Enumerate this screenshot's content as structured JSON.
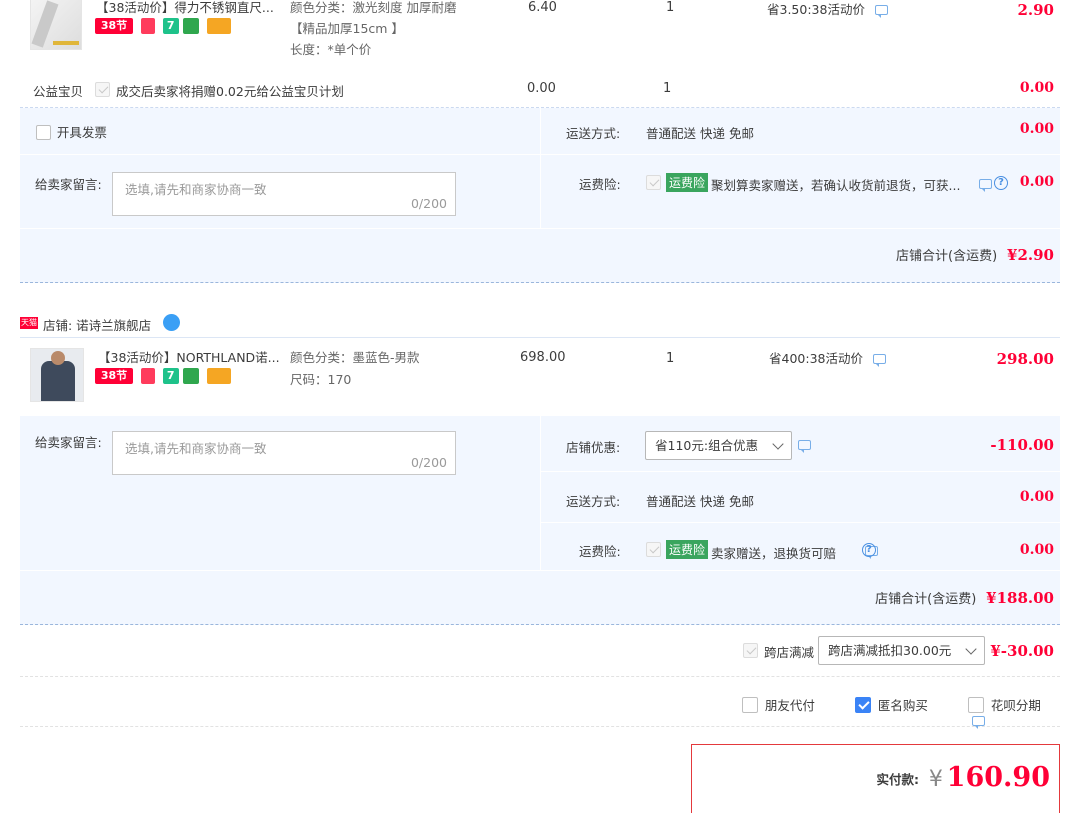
{
  "colors": {
    "price": "#ff0036",
    "panel_bg": "#f2f7ff",
    "checkbox_checked": "#3a83f6",
    "tag_green": "#3aa55e",
    "total_border": "#e4393c"
  },
  "item1": {
    "title": "【38活动价】得力不锈钢直尺...",
    "badges": [
      "38节",
      "shield",
      "7",
      "leaf",
      "card"
    ],
    "attrs": [
      "颜色分类：激光刻度 加厚耐磨",
      "【精品加厚15cm 】",
      "长度：*单个价"
    ],
    "unit_price": "6.40",
    "qty": "1",
    "discount": "省3.50:38活动价",
    "subtotal": "2.90"
  },
  "charity": {
    "label": "公益宝贝",
    "desc": "成交后卖家将捐赠0.02元给公益宝贝计划",
    "price": "0.00",
    "qty": "1",
    "subtotal": "0.00"
  },
  "shop1": {
    "invoice_label": "开具发票",
    "shipping_label": "运送方式:",
    "shipping_value": "普通配送 快递 免邮",
    "shipping_fee": "0.00",
    "message_label": "给卖家留言:",
    "message_placeholder": "选填,请先和商家协商一致",
    "message_count": "0/200",
    "insurance_label": "运费险:",
    "insurance_tag": "运费险",
    "insurance_desc": "聚划算卖家赠送，若确认收货前退货，可获...",
    "insurance_fee": "0.00",
    "total_label": "店铺合计(含运费)",
    "total_value": "¥2.90"
  },
  "shop2": {
    "store_tag": "天猫",
    "store_name": "店铺: 诺诗兰旗舰店",
    "item": {
      "title": "【38活动价】NORTHLAND诺...",
      "badges": [
        "38节",
        "shield",
        "7",
        "leaf",
        "card"
      ],
      "attrs": [
        "颜色分类：墨蓝色-男款",
        "尺码：170"
      ],
      "unit_price": "698.00",
      "qty": "1",
      "discount": "省400:38活动价",
      "subtotal": "298.00"
    },
    "message_label": "给卖家留言:",
    "message_placeholder": "选填,请先和商家协商一致",
    "message_count": "0/200",
    "coupon_label": "店铺优惠:",
    "coupon_value": "省110元:组合优惠",
    "coupon_amount": "-110.00",
    "shipping_label": "运送方式:",
    "shipping_value": "普通配送 快递 免邮",
    "shipping_fee": "0.00",
    "insurance_label": "运费险:",
    "insurance_tag": "运费险",
    "insurance_desc": "卖家赠送，退换货可赔",
    "insurance_fee": "0.00",
    "total_label": "店铺合计(含运费)",
    "total_value": "¥188.00"
  },
  "cross_store": {
    "label": "跨店满减",
    "value": "跨店满减抵扣30.00元",
    "amount": "¥-30.00"
  },
  "options": {
    "friend_pay": "朋友代付",
    "anonymous": "匿名购买",
    "huabei": "花呗分期"
  },
  "payment": {
    "label": "实付款:",
    "currency": "¥",
    "amount": "160.90"
  }
}
